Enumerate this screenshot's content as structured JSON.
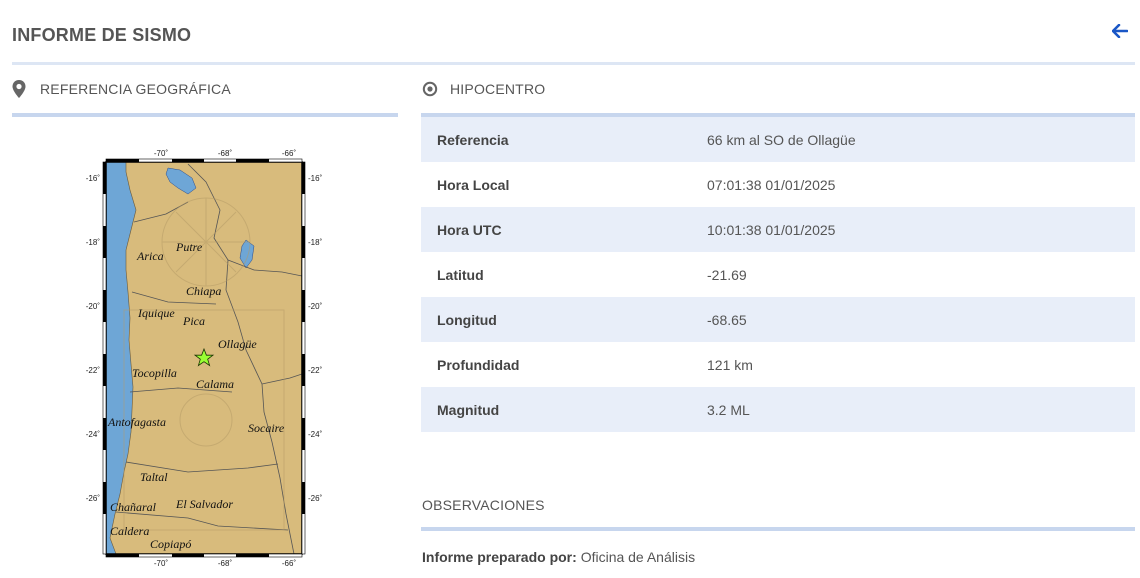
{
  "page": {
    "title": "INFORME DE SISMO",
    "back_icon": "arrow-left-icon",
    "accent_color": "#1a57c6"
  },
  "geo": {
    "heading": "REFERENCIA GEOGRÁFICA",
    "icon": "map-marker-icon",
    "map": {
      "top_ticks": [
        "-70˚",
        "-68˚",
        "-66˚"
      ],
      "bottom_ticks": [
        "-70˚",
        "-68˚",
        "-66˚"
      ],
      "left_ticks": [
        "-16˚",
        "-18˚",
        "-20˚",
        "-22˚",
        "-24˚",
        "-26˚"
      ],
      "right_ticks": [
        "-16˚",
        "-18˚",
        "-20˚",
        "-22˚",
        "-24˚",
        "-26˚"
      ],
      "places": [
        "Putre",
        "Arica",
        "Chiapa",
        "Iquique",
        "Pica",
        "Ollagüe",
        "Tocopilla",
        "Calama",
        "Antofagasta",
        "Socaire",
        "Taltal",
        "Chañaral",
        "El Salvador",
        "Caldera",
        "Copiapó"
      ],
      "epicenter_marker": "star-icon",
      "land_color": "#d8bb7c",
      "sea_color": "#6ea6d6",
      "epicenter_color": "#9aff33"
    }
  },
  "hypocenter": {
    "heading": "HIPOCENTRO",
    "icon": "target-icon",
    "rows": [
      {
        "label": "Referencia",
        "value": "66 km al SO de Ollagüe"
      },
      {
        "label": "Hora Local",
        "value": "07:01:38 01/01/2025"
      },
      {
        "label": "Hora UTC",
        "value": "10:01:38 01/01/2025"
      },
      {
        "label": "Latitud",
        "value": "-21.69"
      },
      {
        "label": "Longitud",
        "value": "-68.65"
      },
      {
        "label": "Profundidad",
        "value": "121 km"
      },
      {
        "label": "Magnitud",
        "value": "3.2 ML"
      }
    ]
  },
  "observations": {
    "heading": "OBSERVACIONES",
    "prepared_label": "Informe preparado por:",
    "prepared_value": "Oficina de Análisis"
  }
}
